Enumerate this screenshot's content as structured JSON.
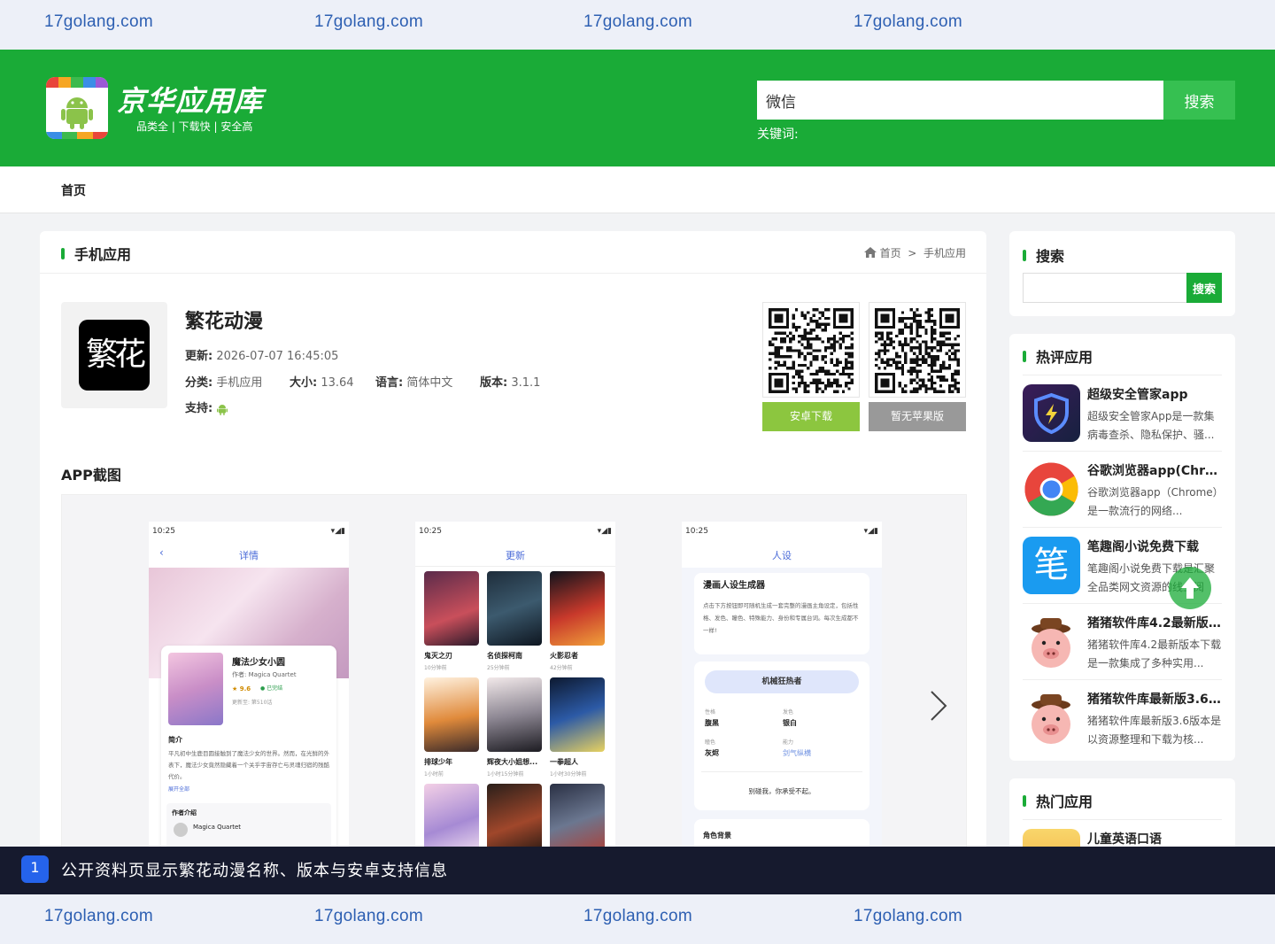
{
  "watermark": {
    "text": "17golang.com"
  },
  "header": {
    "site_title": "京华应用库",
    "slogan": "品类全 | 下载快 | 安全高",
    "search": {
      "value": "微信",
      "button": "搜索"
    },
    "keywords_label": "关键词:"
  },
  "nav": {
    "items": [
      {
        "label": "首页"
      }
    ]
  },
  "section": {
    "title": "手机应用",
    "breadcrumb": {
      "home": "首页",
      "separator": ">",
      "current": "手机应用"
    }
  },
  "app": {
    "icon_text": "繁花",
    "name": "繁花动漫",
    "update_label": "更新:",
    "update_value": "2026-07-07 16:45:05",
    "category_label": "分类:",
    "category_value": "手机应用",
    "size_label": "大小:",
    "size_value": "13.64",
    "language_label": "语言:",
    "language_value": "简体中文",
    "version_label": "版本:",
    "version_value": "3.1.1",
    "support_label": "支持:",
    "android_download": "安卓下载",
    "ios_none": "暂无苹果版"
  },
  "screenshots": {
    "title": "APP截图",
    "phones": [
      {
        "time": "10:25",
        "title": "详情",
        "card_name": "魔法少女小圆",
        "author": "作者: Magica Quartet",
        "rating": "★ 9.6",
        "status": "● 已完结",
        "update_to": "更新至: 第510话",
        "intro_label": "简介",
        "intro_text": "平凡初中生鹿目圆接触到了魔法少女的世界。然而，在光鲜的外表下，魔法少女竟然隐藏着一个关乎宇宙存亡与灵魂归宿的残酷代价。",
        "expand": "展开全部",
        "author_intro": "作者介绍",
        "author_name": "Magica Quartet"
      },
      {
        "time": "10:25",
        "title": "更新",
        "items": [
          {
            "name": "鬼灭之刃",
            "time": "10分钟前",
            "tag": "更新至 1091话"
          },
          {
            "name": "名侦探柯南",
            "time": "25分钟前",
            "tag": "更新至 700话"
          },
          {
            "name": "火影忍者",
            "time": "42分钟前",
            "tag": "更新至 139话"
          },
          {
            "name": "排球少年",
            "time": "1小时前",
            "tag": "更新至 103话"
          },
          {
            "name": "辉夜大小姐想...",
            "time": "1小时15分钟前",
            "tag": "更新至 76话"
          },
          {
            "name": "一拳超人",
            "time": "1小时30分钟前",
            "tag": "更新至 54话"
          }
        ]
      },
      {
        "time": "10:25",
        "title": "人设",
        "gen_title": "漫画人设生成器",
        "gen_desc": "点击下方按钮即可随机生成一套完整的漫画主角设定，包括性格、发色、瞳色、特殊能力、身份和专属台词。每次生成都不一样!",
        "role": "机械狂热者",
        "traits": [
          {
            "k": "性格",
            "v": "腹黑"
          },
          {
            "k": "发色",
            "v": "银白"
          },
          {
            "k": "瞳色",
            "v": "灰烬"
          },
          {
            "k": "能力",
            "v": "剑气纵横"
          }
        ],
        "quote": "别碰我，你承受不起。",
        "background_label": "角色背景"
      }
    ]
  },
  "sidebar": {
    "search_title": "搜索",
    "search_button": "搜索",
    "hot_review_title": "热评应用",
    "hot_review": [
      {
        "name": "超级安全管家app",
        "desc": "超级安全管家App是一款集病毒查杀、隐私保护、骚..."
      },
      {
        "name": "谷歌浏览器app(Chro...",
        "desc": "谷歌浏览器app（Chrome）是一款流行的网络..."
      },
      {
        "name": "笔趣阁小说免费下载",
        "desc": "笔趣阁小说免费下载是汇聚全品类网文资源的线上阅"
      },
      {
        "name": "猪猪软件库4.2最新版...",
        "desc": "猪猪软件库4.2最新版本下载是一款集成了多种实用..."
      },
      {
        "name": "猪猪软件库最新版3.6...",
        "desc": "猪猪软件库最新版3.6版本是以资源整理和下载为核..."
      }
    ],
    "hot_app_title": "热门应用",
    "hot_apps": [
      {
        "name": "儿童英语口语"
      }
    ]
  },
  "caption": {
    "number": "1",
    "text": "公开资料页显示繁花动漫名称、版本与安卓支持信息"
  },
  "colors": {
    "brand_green": "#1aab37",
    "caption_bg": "#161a2e",
    "badge_blue": "#2563eb",
    "watermark": "#2d5fb2"
  }
}
